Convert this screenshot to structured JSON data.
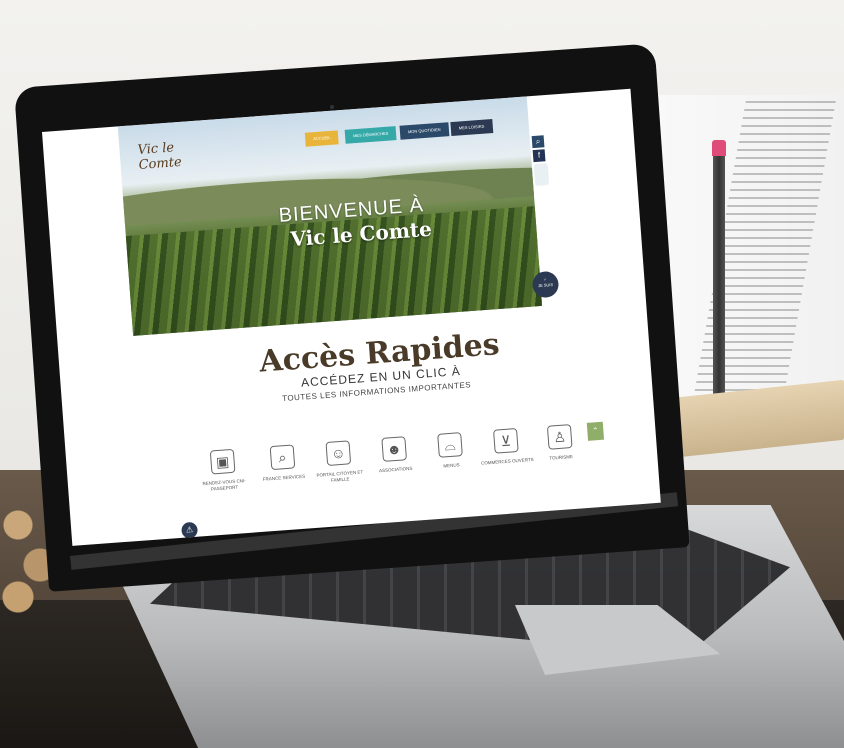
{
  "site": {
    "logo_text": "Vic le Comte",
    "nav": [
      "ACCUEIL",
      "MES DÉMARCHES",
      "MON QUOTIDIEN",
      "MES LOISIRS"
    ],
    "welcome_line1": "BIENVENUE À",
    "welcome_line2": "Vic le Comte",
    "je_suis_label": "JE SUIS",
    "quick_access": {
      "title": "Accès Rapides",
      "subtitle": "ACCÉDEZ EN UN CLIC À",
      "subtitle2": "TOUTES LES INFORMATIONS IMPORTANTES",
      "items": [
        {
          "label": "RENDEZ-VOUS CNI-PASSEPORT",
          "icon": "passport-icon"
        },
        {
          "label": "FRANCE SERVICES",
          "icon": "search-person-icon"
        },
        {
          "label": "PORTAIL CITOYEN ET FAMILLE",
          "icon": "citizen-portal-icon"
        },
        {
          "label": "ASSOCIATIONS",
          "icon": "associations-icon"
        },
        {
          "label": "MENUS",
          "icon": "cloche-icon"
        },
        {
          "label": "COMMERCES OUVERTS",
          "icon": "basket-icon"
        },
        {
          "label": "TOURISME",
          "icon": "hiker-icon"
        }
      ]
    }
  },
  "colors": {
    "nav_accueil": "#e8b53a",
    "nav_demarches": "#35a8a8",
    "nav_quotidien": "#2b4a6a",
    "nav_loisirs": "#2b3a52",
    "scroll_up": "#8fae6a"
  }
}
